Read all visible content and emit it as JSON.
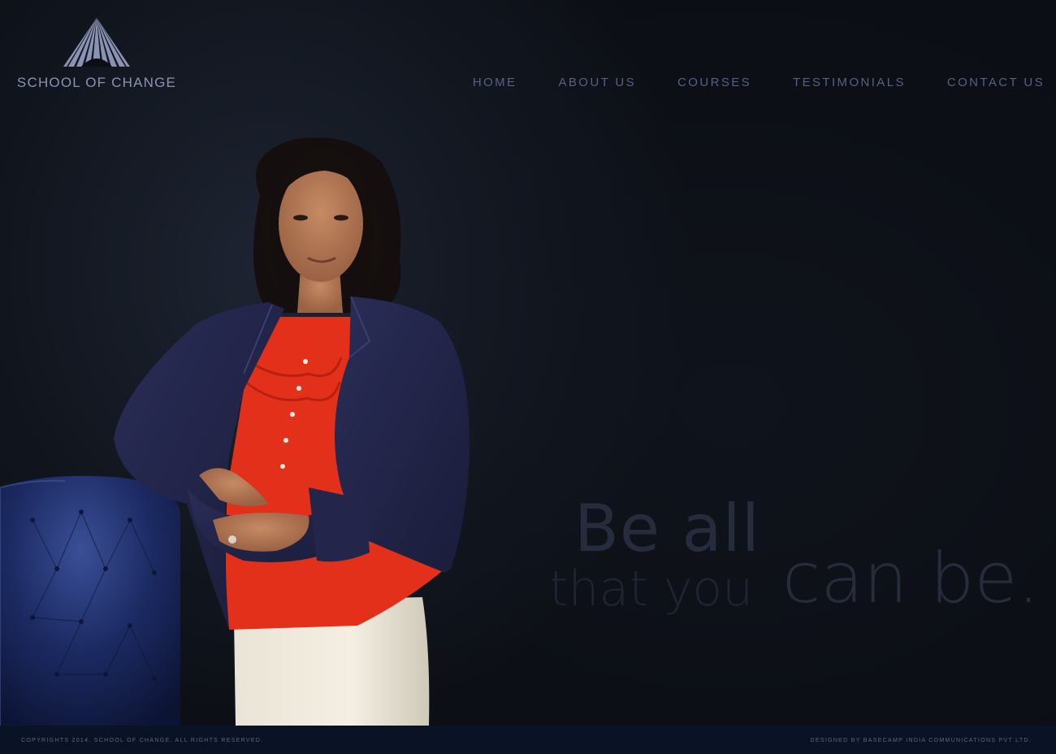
{
  "brand": {
    "name": "SCHOOL OF CHANGE",
    "logo_icon": "fan-triangle-icon",
    "color": "#8a93b3"
  },
  "nav": {
    "items": [
      {
        "label": "HOME"
      },
      {
        "label": "ABOUT US"
      },
      {
        "label": "COURSES"
      },
      {
        "label": "TESTIMONIALS"
      },
      {
        "label": "CONTACT US"
      }
    ]
  },
  "hero": {
    "tagline_line1": "Be all",
    "tagline_line2a": "that you",
    "tagline_line2b": "can be.",
    "image": "portrait of woman in navy blazer and red blouse beside blue tufted leather chair"
  },
  "footer": {
    "left": "COPYRIGHTS 2014. SCHOOL OF CHANGE. ALL RIGHTS RESERVED.",
    "right": "DESIGNED BY BASECAMP INDIA COMMUNICATIONS PVT LTD."
  },
  "colors": {
    "background": "#0b0e14",
    "footer": "#0a1326",
    "nav_text": "#566182",
    "blazer": "#23264a",
    "blouse": "#e32b14"
  }
}
